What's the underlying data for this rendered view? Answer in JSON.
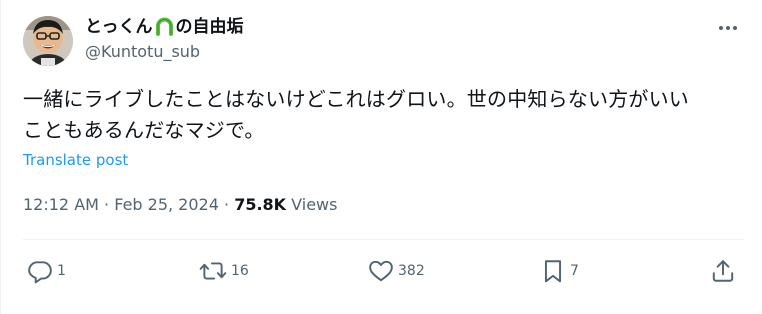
{
  "author": {
    "name_prefix": "とっくん",
    "name_suffix": "の自由垢",
    "handle": "@Kuntotu_sub",
    "badge_icon": "green-horseshoe-emoji"
  },
  "tweet": {
    "text_line1": "一緒にライブしたことはないけどこれはグロい。世の中知らない方がいい",
    "text_line2": "こともあるんだなマジで。",
    "translate_label": "Translate post"
  },
  "meta": {
    "time": "12:12 AM",
    "separator": "·",
    "date": "Feb 25, 2024",
    "views_count": "75.8K",
    "views_label": "Views"
  },
  "actions": {
    "reply_count": "1",
    "repost_count": "16",
    "like_count": "382",
    "bookmark_count": "7"
  },
  "colors": {
    "text": "#0f1419",
    "secondary": "#536471",
    "link": "#1d9bf0",
    "divider": "#eff3f4"
  }
}
